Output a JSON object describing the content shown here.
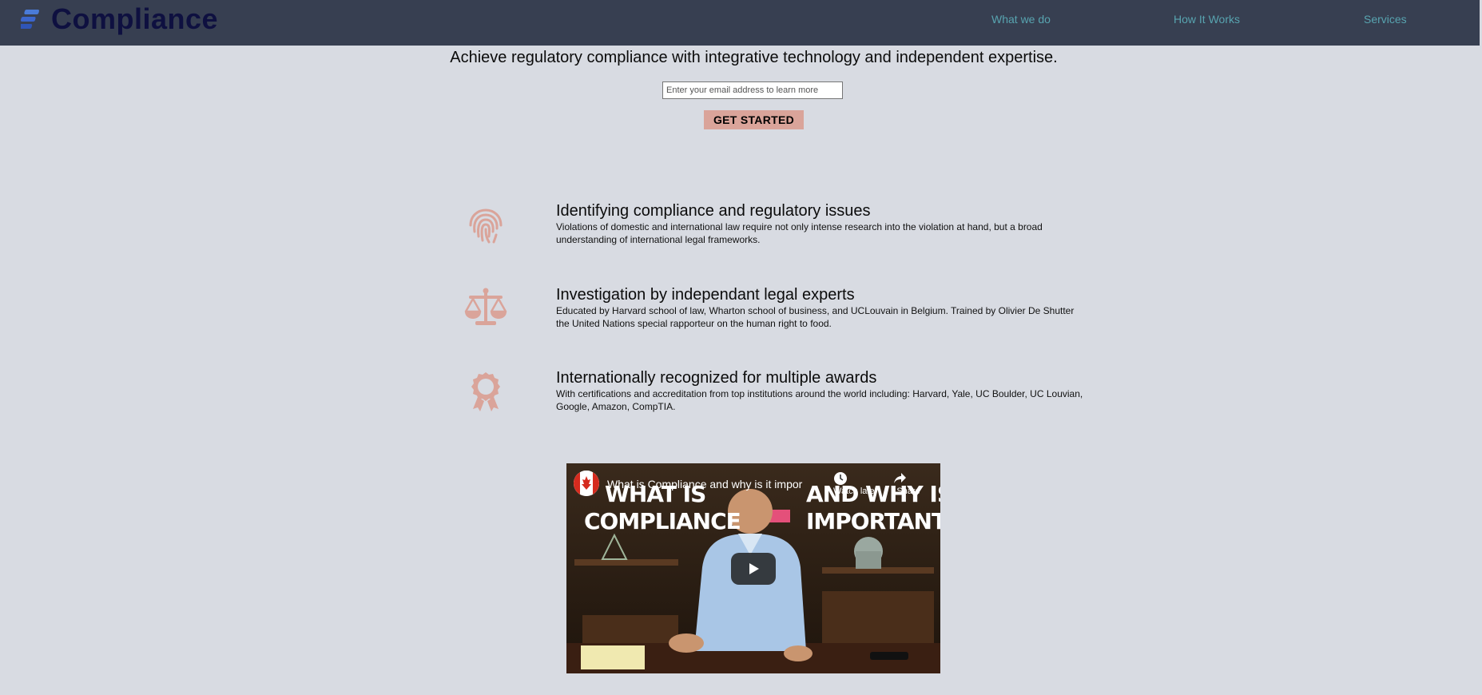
{
  "nav": {
    "brand": "Compliance",
    "links": [
      "What we do",
      "How It Works",
      "Services"
    ]
  },
  "hero": {
    "title": "Achieve regulatory compliance with integrative technology and independent expertise.",
    "email_placeholder": "Enter your email address to learn more",
    "cta_label": "GET STARTED"
  },
  "features": [
    {
      "icon": "fingerprint-icon",
      "title": "Identifying compliance and regulatory issues",
      "text": "Violations of domestic and international law require not only intense research into the violation at hand, but a broad understanding of international legal frameworks."
    },
    {
      "icon": "balance-scale-icon",
      "title": "Investigation by independant legal experts",
      "text": "Educated by Harvard school of law, Wharton school of business, and UCLouvain in Belgium. Trained by Olivier De Shutter the United Nations special rapporteur on the human right to food."
    },
    {
      "icon": "award-icon",
      "title": "Internationally recognized for multiple awards",
      "text": "With certifications and accreditation from top institutions around the world including: Harvard, Yale, UC Boulder, UC Louvian, Google, Amazon, CompTIA."
    }
  ],
  "video": {
    "title": "What is Compliance and why is it impor",
    "watch_later": "Watch later",
    "share": "Share",
    "overlay_left_1": "WHAT IS",
    "overlay_left_2": "COMPLIANCE",
    "overlay_right_1": "AND WHY IS IT",
    "overlay_right_2": "IMPORTANT?"
  },
  "colors": {
    "navbar": "#373f51",
    "background": "#d8dbe2",
    "accent": "#daa49a",
    "link": "#58a4b0",
    "brand": "#0e1040"
  }
}
